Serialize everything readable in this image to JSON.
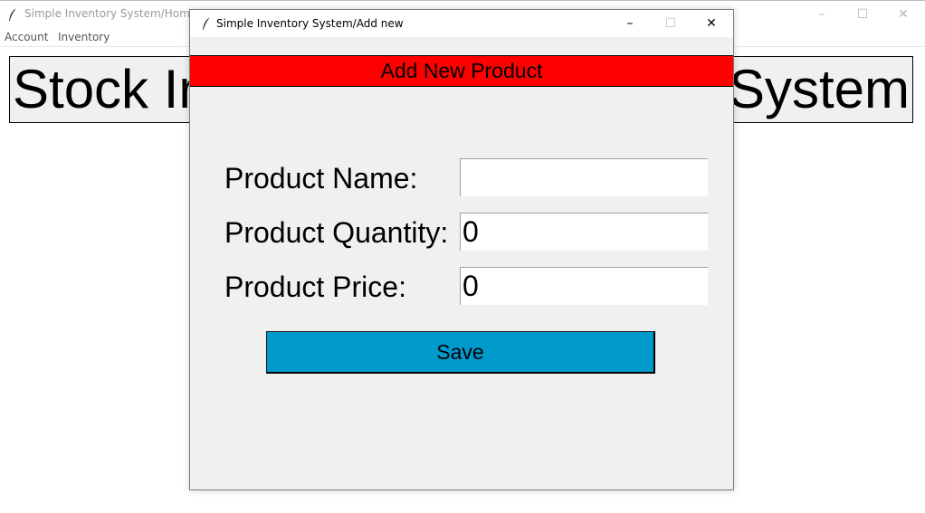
{
  "home_window": {
    "title": "Simple Inventory System/Home",
    "menu": [
      "Account",
      "Inventory"
    ],
    "banner_left": "Stock Ir",
    "banner_right": "System",
    "controls": {
      "minimize": "–",
      "maximize": "☐",
      "close": "✕"
    }
  },
  "dialog": {
    "title": "Simple Inventory System/Add new",
    "controls": {
      "minimize": "–",
      "maximize": "☐",
      "close": "✕"
    },
    "header": "Add New Product",
    "header_color": "#ff0000",
    "fields": [
      {
        "label": "Product Name:",
        "value": ""
      },
      {
        "label": "Product Quantity:",
        "value": "0"
      },
      {
        "label": "Product Price:",
        "value": "0"
      }
    ],
    "save_label": "Save",
    "save_color": "#0099cc"
  }
}
